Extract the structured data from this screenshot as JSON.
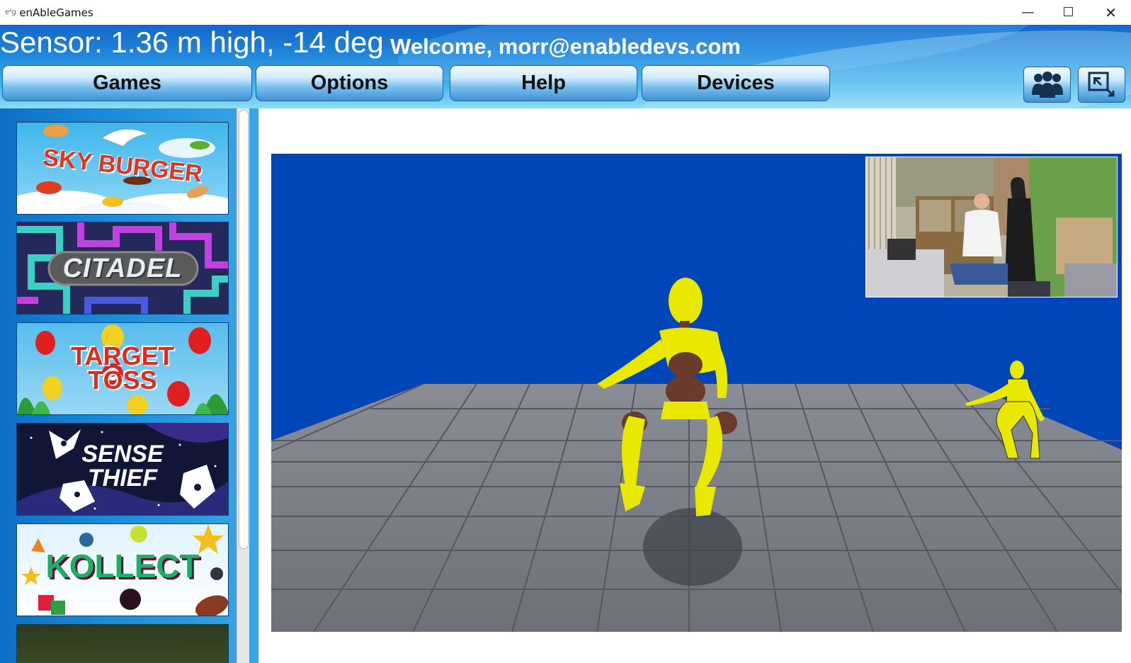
{
  "window": {
    "logo": "eᴬg",
    "title": "enAbleGames",
    "minimize": "—",
    "maximize": "☐",
    "close": "✕"
  },
  "header": {
    "sensor_text": "Sensor: 1.36 m high, -14 deg",
    "welcome_text": "Welcome, morr@enabledevs.com"
  },
  "nav": {
    "games": "Games",
    "options": "Options",
    "help": "Help",
    "devices": "Devices"
  },
  "toolbar_icons": {
    "users": "users-icon",
    "exit_fullscreen": "exit-fullscreen-icon"
  },
  "games": [
    {
      "title": "SKY BURGER",
      "bg": "#5fc2ee"
    },
    {
      "title": "CITADEL",
      "bg": "#2b2f6a"
    },
    {
      "title": "TARGET TOSS",
      "bg": "#6cc9f0"
    },
    {
      "title": "SENSE THIEF",
      "bg": "#141a3a"
    },
    {
      "title": "KOLLECT",
      "bg": "#e9f6ff"
    }
  ],
  "scene": {
    "sky_color": "#0046b8",
    "floor_color": "#7d7f88",
    "avatar_color": "#e8e800"
  }
}
